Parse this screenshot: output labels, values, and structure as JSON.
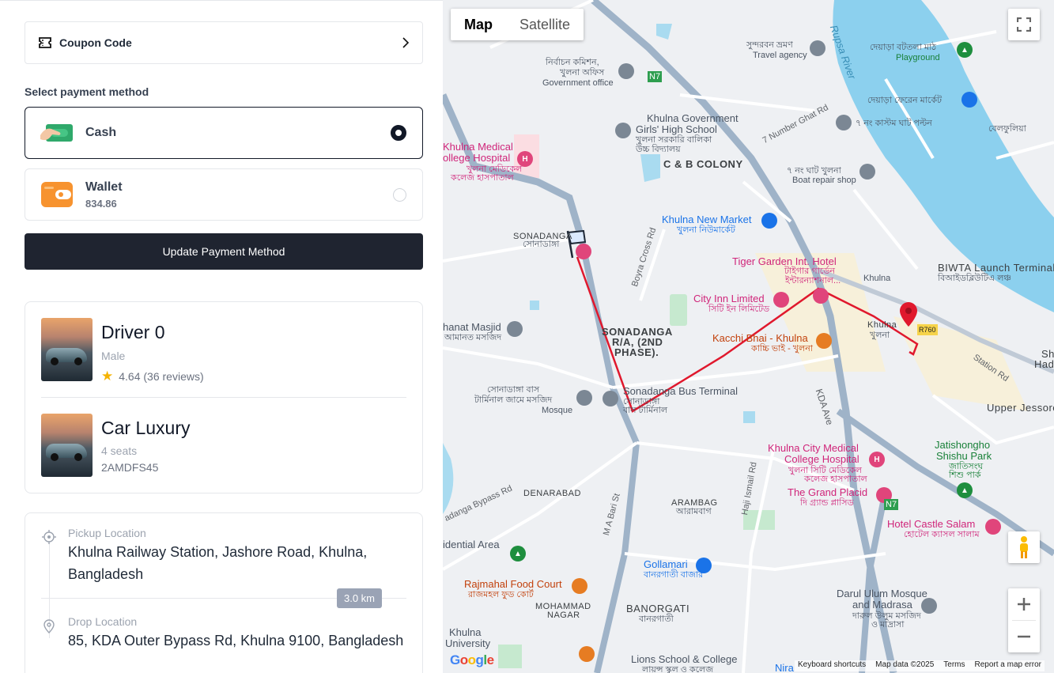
{
  "coupon": {
    "label": "Coupon Code"
  },
  "payment": {
    "title": "Select payment method",
    "options": [
      {
        "name": "Cash",
        "sub": "",
        "selected": true
      },
      {
        "name": "Wallet",
        "sub": "834.86",
        "selected": false
      }
    ],
    "update_label": "Update Payment Method"
  },
  "driver": {
    "name": "Driver 0",
    "gender": "Male",
    "rating": "4.64 (36 reviews)"
  },
  "car": {
    "name": "Car Luxury",
    "seats": "4 seats",
    "plate": "2AMDFS45"
  },
  "route": {
    "pickup_label": "Pickup Location",
    "pickup_value": "Khulna Railway Station, Jashore Road, Khulna, Bangladesh",
    "drop_label": "Drop Location",
    "drop_value": "85, KDA Outer Bypass Rd, Khulna 9100, Bangladesh",
    "distance": "3.0 km"
  },
  "map": {
    "type_tabs": [
      "Map",
      "Satellite"
    ],
    "active_tab": "Map",
    "footer": [
      "Keyboard shortcuts",
      "Map data ©2025",
      "Terms",
      "Report a map error"
    ],
    "google": "Google",
    "route_color": "#e0182d",
    "labels": {
      "rupsa_river": "Rupsa River",
      "sundarban": "সুন্দরবন ভ্রমণ",
      "travel_agency": "Travel agency",
      "deyara_playground": "দেয়াড়া বটতলা মাঠ",
      "playground": "Playground",
      "commissioner": "নির্বাচন কমিশন,",
      "commissioner2": "খুলনা অফিস",
      "govt_office": "Government office",
      "n7": "N7",
      "kgghs": "Khulna Government",
      "kgghs2": "Girls' High School",
      "kgghs3": "খুলনা সরকারি বালিকা",
      "kgghs4": "উচ্চ বিদ্যালয়",
      "deyara_market": "দেয়াড়া ফেরেন মার্কেট",
      "seven_ghat": "৭ নং কাস্টম ঘাট পল্টন",
      "belphulia": "বেলফুলিয়া",
      "seven_number_ghat_rd": "7 Number Ghat Rd",
      "kmch": "Khulna Medical",
      "kmch2": "ollege Hospital",
      "kmch3": "খুলনা মেডিকেল",
      "kmch4": "কলেজ হাসপাতাল",
      "cb_colony": "C & B COLONY",
      "boat_repair": "৭ নং ঘাট খুলনা",
      "boat_repair2": "Boat repair shop",
      "new_market": "Khulna New Market",
      "new_market2": "খুলনা নিউমার্কেট",
      "sonadanga": "SONADANGA",
      "sonadanga_bn": "সোনাডাঙ্গা",
      "boyra_rd": "Boyra Cross Rd",
      "tiger_garden": "Tiger Garden Int. Hotel",
      "tiger_garden2": "টাইগার গার্ডেন",
      "tiger_garden3": "ইন্টারন্যাশনাল...",
      "biwta": "BIWTA Launch Terminal",
      "biwta2": "বিআইডব্লিউটিএ লঞ্চ",
      "khulna_st": "Khulna",
      "city_inn": "City Inn Limited",
      "city_inn2": "সিটি ইন লিমিটেড",
      "masjid": "hanat Masjid",
      "masjid2": "আমানত মসজিদ",
      "sonadanga_ra": "SONADANGA",
      "sonadanga_ra2": "R/A, (2ND",
      "sonadanga_ra3": "PHASE).",
      "kacchi": "Kacchi Bhai - Khulna",
      "kacchi2": "কাচ্চি ভাই - খুলনা",
      "khulna_pin": "Khulna",
      "khulna_pin2": "খুলনা",
      "r760": "R760",
      "station_rd": "Station Rd",
      "hadis": "Sha",
      "hadis2": "Hadis",
      "bus_mosque": "সোনাডাঙ্গা বাস",
      "bus_mosque2": "টার্মিনাল জামে মসজিদ",
      "bus_mosque3": "Mosque",
      "bus_terminal": "Sonadanga Bus Terminal",
      "bus_terminal2": "সোনাডাঙ্গা",
      "bus_terminal3": "বাস টার্মিনাল",
      "kda_ave": "KDA Ave",
      "upper_jessore": "Upper Jessore",
      "kcmch": "Khulna City Medical",
      "kcmch2": "College Hospital",
      "kcmch3": "খুলনা সিটি মেডিকেল",
      "kcmch4": "কলেজ হাসপাতাল",
      "jatishongho": "Jatishongho",
      "jatishongho2": "Shishu Park",
      "jatishongho3": "জাতিসংঘ",
      "jatishongho4": "শিশু পার্ক",
      "bypass_rd": "adanga Bypass Rd",
      "denarabad": "DENARABAD",
      "haji_ismail": "Haji Ismail Rd",
      "grand_placid": "The Grand Placid",
      "grand_placid2": "দি গ্র্যান্ড প্লাসিড",
      "arambag": "ARAMBAG",
      "arambag2": "আরামবাগ",
      "castle_salam": "Hotel Castle Salam",
      "castle_salam2": "হোটেল ক্যাসল সালাম",
      "residential": "idential Area",
      "mabari": "M A Bari St",
      "gollamari": "Gollamari",
      "gollamari2": "বানরগাতী বাজার",
      "rajmahal": "Rajmahal Food Court",
      "rajmahal2": "রাজমহল ফুড কোর্ট",
      "mohammad": "MOHAMMAD",
      "nagar": "NAGAR",
      "banorgati": "BANORGATI",
      "banorgati2": "বানরগাতী",
      "darul_ulum": "Darul Ulum Mosque",
      "darul_ulum2": "and Madrasa",
      "darul_ulum3": "দারুল উলুম মসজিদ",
      "darul_ulum4": "ও মাদ্রাসা",
      "ku": "Khulna",
      "ku2": "University",
      "lions": "Lions School & College",
      "lions2": "লায়ন্স স্কুল ও কলেজ",
      "nira": "Nira",
      "n7b": "N7"
    }
  }
}
